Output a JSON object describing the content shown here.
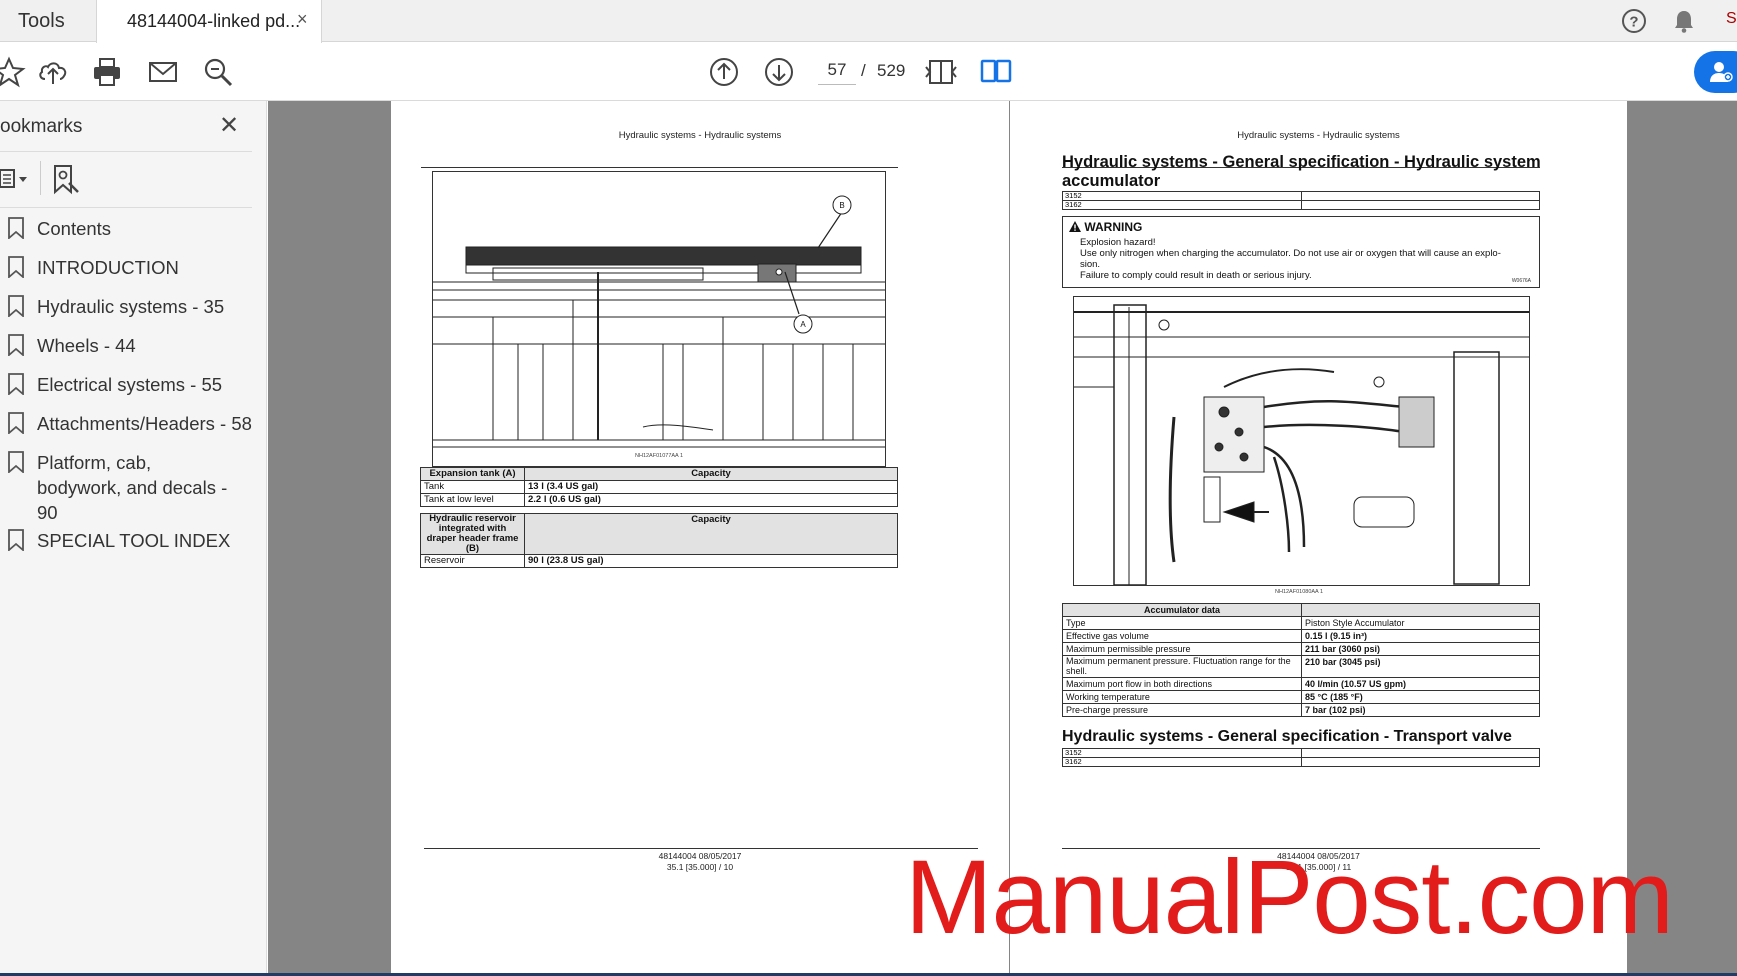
{
  "tabs": {
    "tools_label": "Tools",
    "document_title": "48144004-linked pd...",
    "close_glyph": "×"
  },
  "toolbar": {
    "current_page": "57",
    "page_separator": "/",
    "total_pages": "529",
    "icons": [
      "star-icon",
      "upload-icon",
      "print-icon",
      "mail-icon",
      "zoom-icon",
      "prev-page-icon",
      "next-page-icon",
      "fit-page-icon",
      "two-page-icon",
      "help-icon",
      "bell-icon",
      "share-icon"
    ]
  },
  "sidebar": {
    "title": "ookmarks",
    "close_glyph": "✕",
    "bookmarks": [
      {
        "label": "Contents"
      },
      {
        "label": "INTRODUCTION"
      },
      {
        "label": "Hydraulic systems - 35"
      },
      {
        "label": "Wheels - 44"
      },
      {
        "label": "Electrical systems - 55"
      },
      {
        "label": "Attachments/Headers - 58"
      },
      {
        "label": "Platform, cab, bodywork, and decals - 90"
      },
      {
        "label": "SPECIAL TOOL INDEX"
      }
    ]
  },
  "left_page": {
    "running_head": "Hydraulic systems - Hydraulic systems",
    "figure_caption": "NH12AF01077AA   1",
    "callout_b": "B",
    "callout_a": "A",
    "expansion_table": {
      "headers": [
        "Expansion tank (A)",
        "Capacity"
      ],
      "rows": [
        [
          "Tank",
          "13 l (3.4 US gal)"
        ],
        [
          "Tank at low level",
          "2.2 l (0.6 US gal)"
        ]
      ]
    },
    "reservoir_table": {
      "headers": [
        "Hydraulic reservoir integrated with draper header frame (B)",
        "Capacity"
      ],
      "rows": [
        [
          "Reservoir",
          "90 l (23.8 US gal)"
        ]
      ]
    },
    "footer_line1": "48144004 08/05/2017",
    "footer_line2": "35.1 [35.000] / 10"
  },
  "right_page": {
    "running_head": "Hydraulic systems - Hydraulic systems",
    "section1_title": "Hydraulic systems - General specification - Hydraulic system accumulator",
    "models": [
      "3152",
      "3162"
    ],
    "warning": {
      "title": "WARNING",
      "lines": [
        "Explosion hazard!",
        "Use only nitrogen when charging the accumulator. Do not use air or oxygen that will cause an explo-",
        "sion.",
        "Failure to comply could result in death or serious injury."
      ],
      "code": "W0676A"
    },
    "figure_caption": "NH12AF01080AA   1",
    "accumulator_table": {
      "headers": [
        "Accumulator data",
        ""
      ],
      "rows": [
        [
          "Type",
          "Piston Style Accumulator"
        ],
        [
          "Effective gas volume",
          "0.15 l (9.15 in³)"
        ],
        [
          "Maximum permissible pressure",
          "211 bar (3060 psi)"
        ],
        [
          "Maximum permanent pressure.  Fluctuation range for the shell.",
          "210 bar (3045 psi)"
        ],
        [
          "Maximum port flow in both directions",
          "40 l/min (10.57 US gpm)"
        ],
        [
          "Working temperature",
          "85 °C (185 °F)"
        ],
        [
          "Pre-charge pressure",
          "7 bar (102 psi)"
        ]
      ]
    },
    "section2_title": "Hydraulic systems - General specification - Transport valve",
    "footer_line1": "48144004 08/05/2017",
    "footer_line2": "35.1 [35.000] / 11"
  },
  "watermark": "ManualPost.com",
  "colors": {
    "accent_blue": "#1473e6",
    "watermark_red": "#e21b1b",
    "viewer_gray": "#858585"
  }
}
